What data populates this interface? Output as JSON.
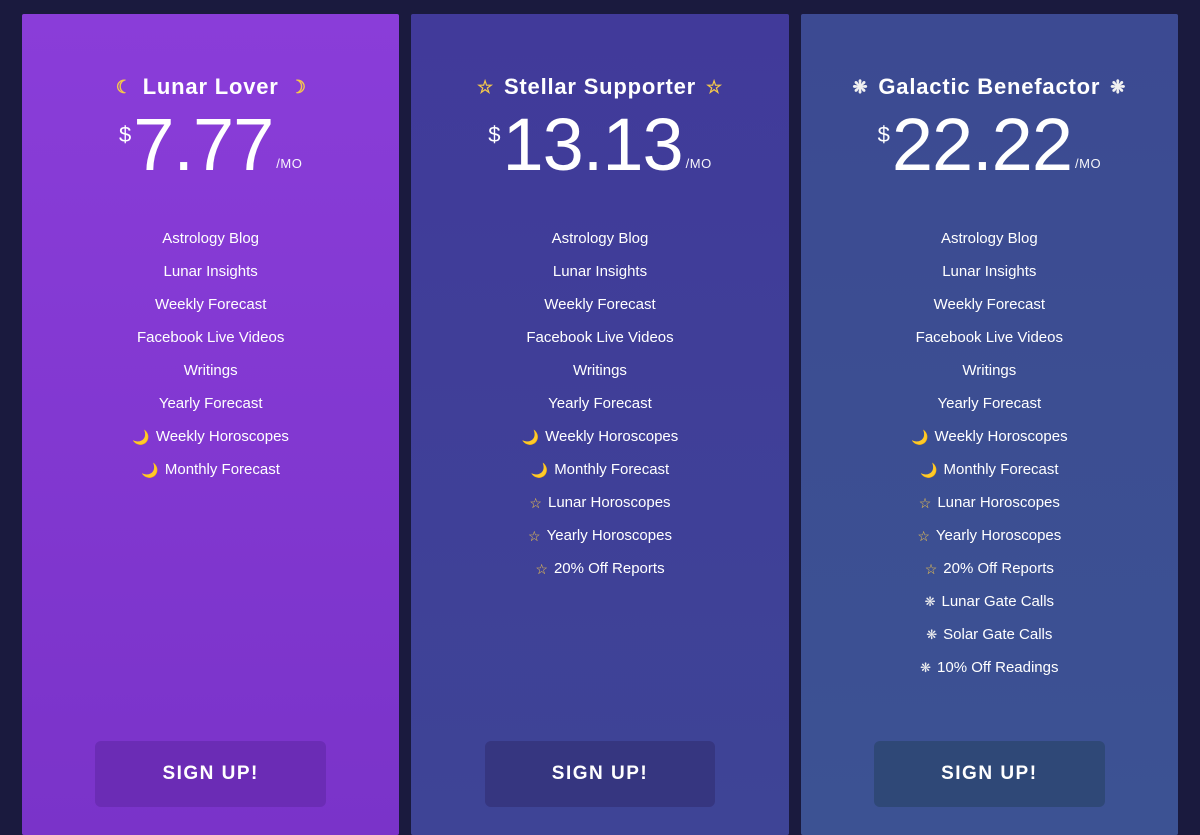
{
  "icons": {
    "moon": "☾",
    "star": "☆",
    "sun": "❋",
    "crescent": "🌙"
  },
  "tiers": [
    {
      "icon_key": "moon",
      "title": "Lunar Lover",
      "currency": "$",
      "price": "7.77",
      "period": "/MO",
      "features": [
        {
          "icon": null,
          "label": "Astrology Blog"
        },
        {
          "icon": null,
          "label": "Lunar Insights"
        },
        {
          "icon": null,
          "label": "Weekly Forecast"
        },
        {
          "icon": null,
          "label": "Facebook Live Videos"
        },
        {
          "icon": null,
          "label": "Writings"
        },
        {
          "icon": null,
          "label": "Yearly Forecast"
        },
        {
          "icon": "crescent",
          "label": "Weekly Horoscopes"
        },
        {
          "icon": "crescent",
          "label": "Monthly Forecast"
        }
      ],
      "cta": "SIGN UP!"
    },
    {
      "icon_key": "star",
      "title": "Stellar Supporter",
      "currency": "$",
      "price": "13.13",
      "period": "/MO",
      "features": [
        {
          "icon": null,
          "label": "Astrology Blog"
        },
        {
          "icon": null,
          "label": "Lunar Insights"
        },
        {
          "icon": null,
          "label": "Weekly Forecast"
        },
        {
          "icon": null,
          "label": "Facebook Live Videos"
        },
        {
          "icon": null,
          "label": "Writings"
        },
        {
          "icon": null,
          "label": "Yearly Forecast"
        },
        {
          "icon": "crescent",
          "label": "Weekly Horoscopes"
        },
        {
          "icon": "crescent",
          "label": "Monthly Forecast"
        },
        {
          "icon": "star",
          "label": "Lunar Horoscopes"
        },
        {
          "icon": "star",
          "label": "Yearly Horoscopes"
        },
        {
          "icon": "star",
          "label": "20% Off Reports"
        }
      ],
      "cta": "SIGN UP!"
    },
    {
      "icon_key": "sun",
      "title": "Galactic Benefactor",
      "currency": "$",
      "price": "22.22",
      "period": "/MO",
      "features": [
        {
          "icon": null,
          "label": "Astrology Blog"
        },
        {
          "icon": null,
          "label": "Lunar Insights"
        },
        {
          "icon": null,
          "label": "Weekly Forecast"
        },
        {
          "icon": null,
          "label": "Facebook Live Videos"
        },
        {
          "icon": null,
          "label": "Writings"
        },
        {
          "icon": null,
          "label": "Yearly Forecast"
        },
        {
          "icon": "crescent",
          "label": "Weekly Horoscopes"
        },
        {
          "icon": "crescent",
          "label": "Monthly Forecast"
        },
        {
          "icon": "star",
          "label": "Lunar Horoscopes"
        },
        {
          "icon": "star",
          "label": "Yearly Horoscopes"
        },
        {
          "icon": "star",
          "label": "20% Off Reports"
        },
        {
          "icon": "sun",
          "label": "Lunar Gate Calls"
        },
        {
          "icon": "sun",
          "label": "Solar Gate Calls"
        },
        {
          "icon": "sun",
          "label": "10% Off Readings"
        }
      ],
      "cta": "SIGN UP!"
    }
  ]
}
